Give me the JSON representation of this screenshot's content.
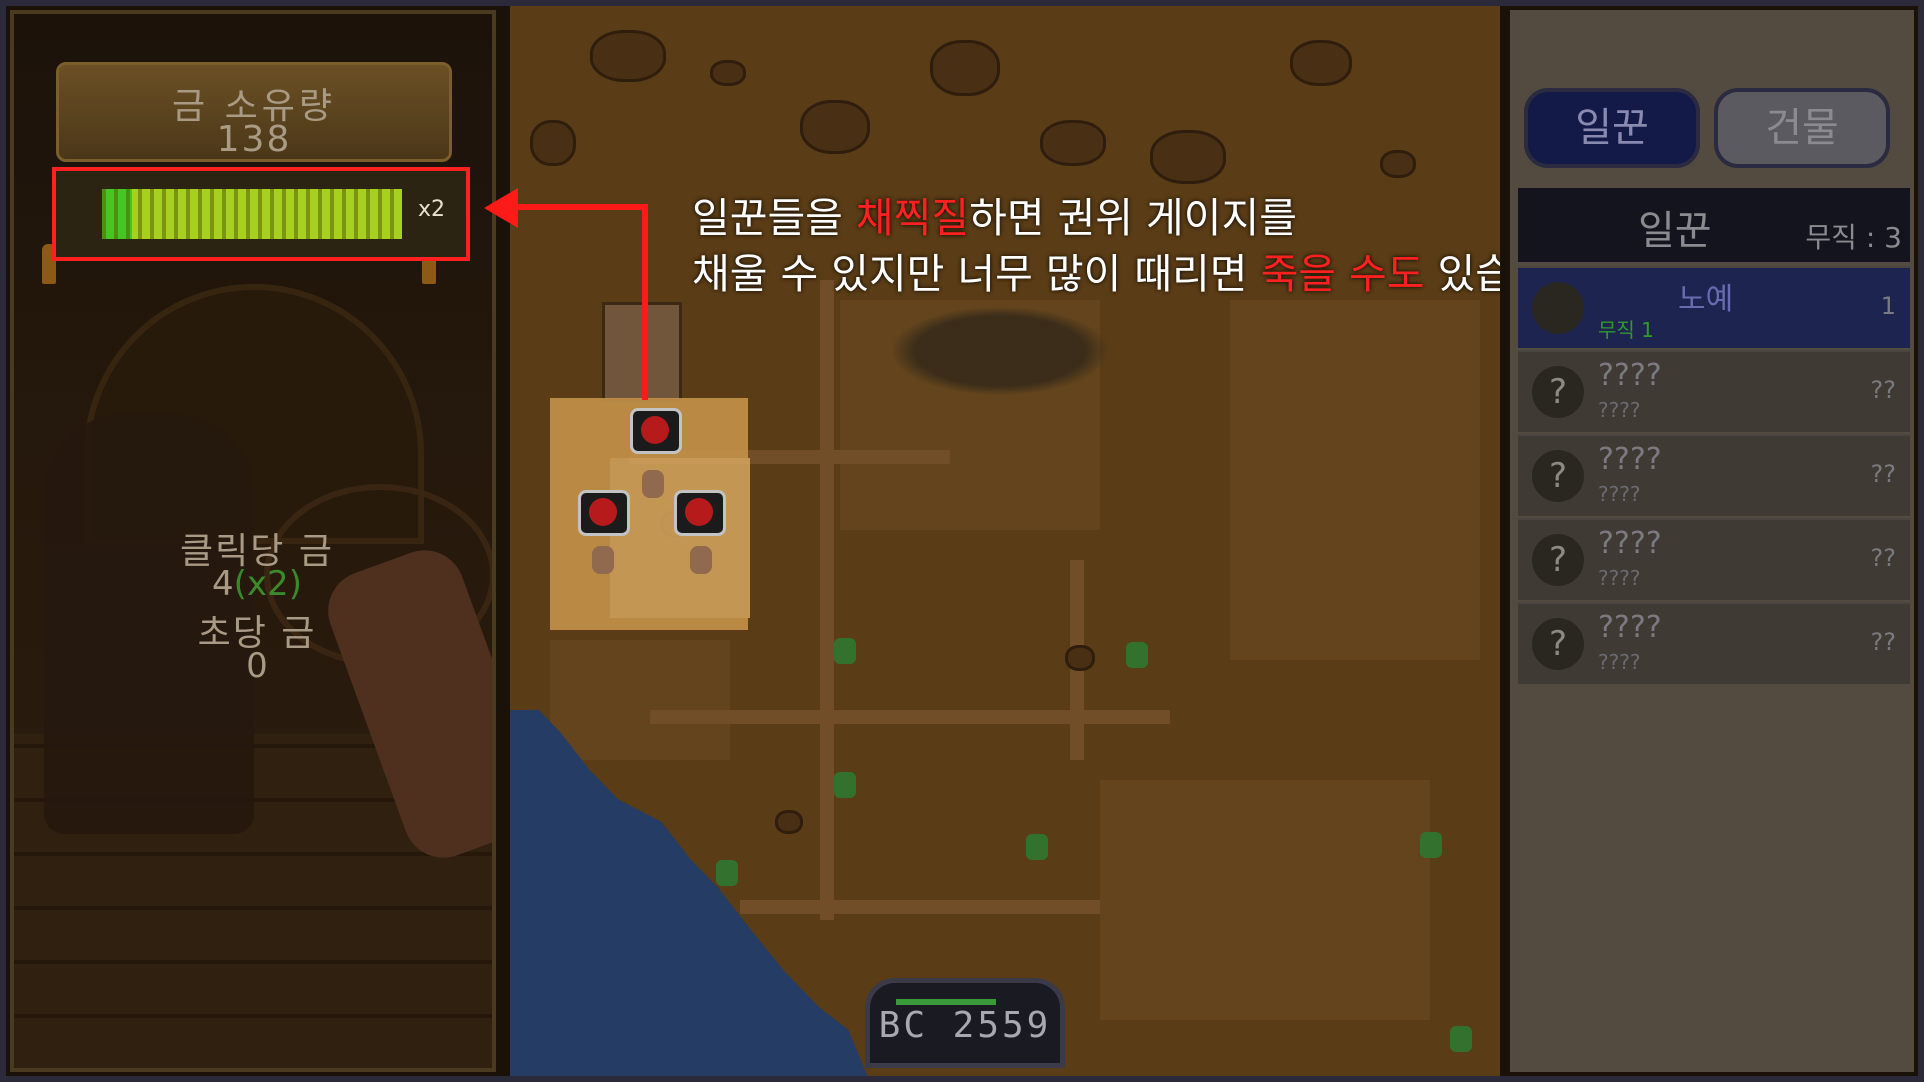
{
  "left_panel": {
    "gold_label": "금 소유량",
    "gold_value": "138",
    "gauge_multiplier": "x2",
    "gauge_fill_fraction": 0.1,
    "per_click_label": "클릭당 금",
    "per_click_value": "4",
    "per_click_bonus": "(x2)",
    "per_second_label": "초당 금",
    "per_second_value": "0"
  },
  "map": {
    "callout_line1_a": "일꾼들을 ",
    "callout_line1_red": "채찍질",
    "callout_line1_b": "하면 권위 게이지를",
    "callout_line2_a": "채울 수 있지만 너무 많이 때리면 ",
    "callout_line2_red": "죽을 수도",
    "callout_line2_b": " 있습니다.",
    "year": "BC 2559"
  },
  "right_panel": {
    "tabs": [
      {
        "label": "일꾼",
        "active": true
      },
      {
        "label": "건물",
        "active": false
      }
    ],
    "section_title": "일꾼",
    "section_count": "무직 : 3",
    "rows": [
      {
        "icon": "?",
        "name": "노예",
        "sub": "무직 1",
        "num": "1",
        "active": true
      },
      {
        "icon": "?",
        "name": "????",
        "sub": "????",
        "num": "??",
        "active": false
      },
      {
        "icon": "?",
        "name": "????",
        "sub": "????",
        "num": "??",
        "active": false
      },
      {
        "icon": "?",
        "name": "????",
        "sub": "????",
        "num": "??",
        "active": false
      },
      {
        "icon": "?",
        "name": "????",
        "sub": "????",
        "num": "??",
        "active": false
      }
    ]
  },
  "colors": {
    "highlight_red": "#ff2020",
    "gauge_green": "#46c622",
    "gauge_yellow": "#a8d020",
    "bonus_green": "#3a8a2a"
  }
}
